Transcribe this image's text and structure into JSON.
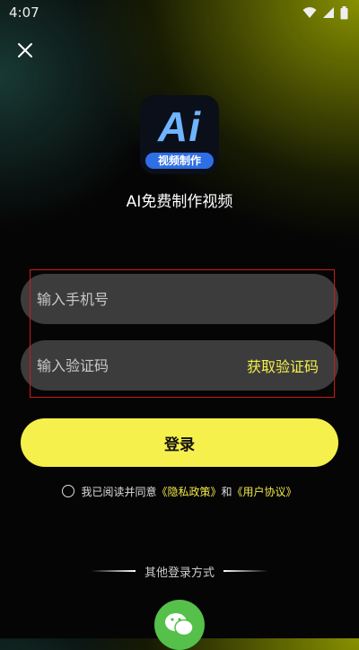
{
  "status_bar": {
    "time": "4:07"
  },
  "header": {
    "close_icon": "close-icon"
  },
  "app": {
    "logo_text": "Ai",
    "logo_badge": "视频制作",
    "title": "AI免费制作视频"
  },
  "form": {
    "phone_placeholder": "输入手机号",
    "code_placeholder": "输入验证码",
    "get_code_label": "获取验证码",
    "login_label": "登录"
  },
  "agreement": {
    "prefix": "我已阅读并同意",
    "privacy_link": "《隐私政策》",
    "connector": "和",
    "terms_link": "《用户协议》"
  },
  "other_login": {
    "label": "其他登录方式",
    "wechat_icon": "wechat-icon"
  },
  "colors": {
    "accent": "#f6f04c",
    "highlight_border": "#d01818",
    "wechat": "#55c04a"
  }
}
